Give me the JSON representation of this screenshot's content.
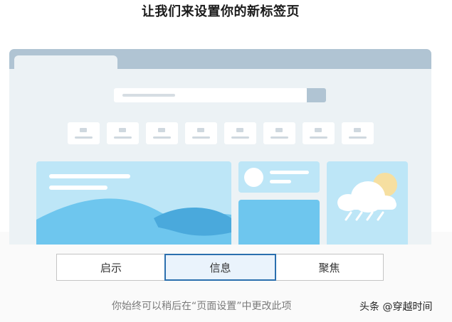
{
  "title": "让我们来设置你的新标签页",
  "segments": [
    {
      "label": "启示",
      "selected": false
    },
    {
      "label": "信息",
      "selected": true
    },
    {
      "label": "聚焦",
      "selected": false
    }
  ],
  "hint": "你始终可以稍后在“页面设置”中更改此项",
  "watermark": "头条 @穿越时间",
  "colors": {
    "accent": "#2b6fae",
    "selected_bg": "#eaf3fc",
    "preview_bg": "#ecf2f5",
    "tabbar": "#b0c4d3",
    "card_light": "#bde6f7",
    "card_blue": "#6ec6ee"
  }
}
